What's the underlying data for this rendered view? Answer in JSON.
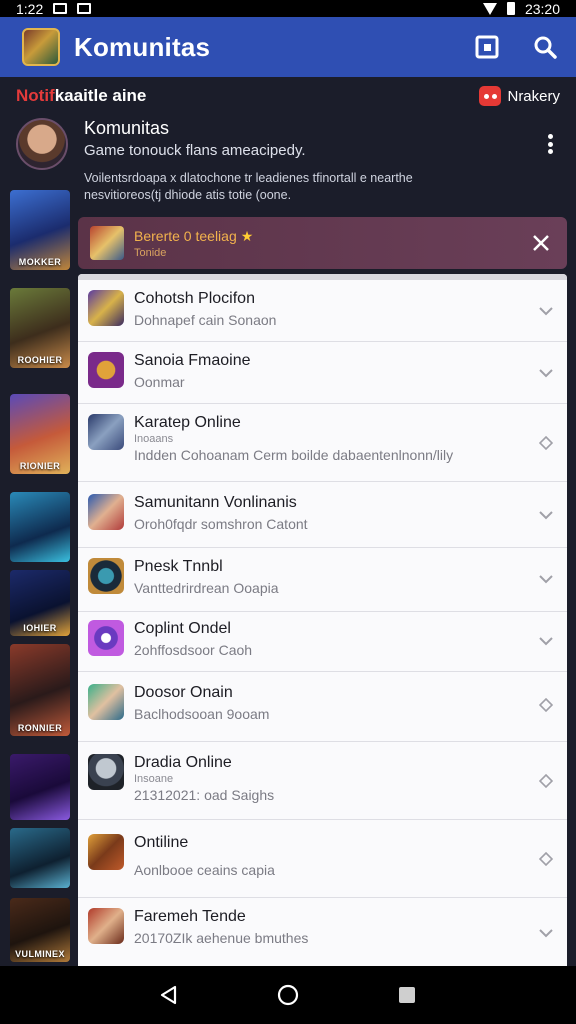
{
  "status_bar": {
    "time": "1:22",
    "clock_right": "23:20"
  },
  "app_bar": {
    "title": "Komunitas",
    "icons": [
      "app-logo",
      "filter-icon",
      "search-icon"
    ]
  },
  "notif_row": {
    "label_red": "Notif",
    "label_rest": "kaaitle aine",
    "right_label": "Nrakery"
  },
  "profile": {
    "name": "Komunitas",
    "subtitle": "Game tonouck flans ameacipedy.",
    "description": "Voilentsrdoapa x dlatochone tr leadienes tfinortall e nearthe nesvitioreos(tj dhiode atis totie (oone."
  },
  "thumbs": [
    {
      "label": "MOKKER"
    },
    {
      "label": "ROOHIER"
    },
    {
      "label": "RIONIER"
    },
    {
      "label": ""
    },
    {
      "label": "IOHIER"
    },
    {
      "label": "RONNIER"
    },
    {
      "label": ""
    },
    {
      "label": ""
    },
    {
      "label": "VULMINEX"
    }
  ],
  "banner": {
    "title": "Bererte 0 teeliag",
    "star": "★",
    "subtitle": "Tonide"
  },
  "list": [
    {
      "title": "Cohotsh Plocifon",
      "tag": "",
      "subtitle": "Dohnapef cain Sonaon",
      "chevron": "down"
    },
    {
      "title": "Sanoia Fmaoine",
      "tag": "",
      "subtitle": "Oonmar",
      "chevron": "down"
    },
    {
      "title": "Karatep Online",
      "tag": "Inoaans",
      "subtitle": "Indden Cohoanam Cerm boilde dabaentenlnonn/lily",
      "chevron": "diamond"
    },
    {
      "title": "Samunitann Vonlinanis",
      "tag": "",
      "subtitle": "Oroh0fqdr somshron Catont",
      "chevron": "down"
    },
    {
      "title": "Pnesk Tnnbl",
      "tag": "",
      "subtitle": "Vanttedrirdrean Ooapia",
      "chevron": "down"
    },
    {
      "title": "Coplint Ondel",
      "tag": "",
      "subtitle": "2ohffosdsoor Caoh",
      "chevron": "down"
    },
    {
      "title": "Doosor Onain",
      "tag": "",
      "subtitle": "Baclhodsooan 9ooam",
      "chevron": "diamond"
    },
    {
      "title": "Dradia Online",
      "tag": "Insoane",
      "subtitle": "21312021: oad Saighs",
      "chevron": "diamond"
    },
    {
      "title": "Ontiline",
      "tag": "",
      "subtitle": "Aonlbooe ceains capia",
      "chevron": "diamond"
    },
    {
      "title": "Faremeh Tende",
      "tag": "",
      "subtitle": "20170ZIk aehenue bmuthes",
      "chevron": "down"
    }
  ],
  "nav_bar": {
    "buttons": [
      "back-icon",
      "home-icon",
      "recents-icon"
    ]
  }
}
